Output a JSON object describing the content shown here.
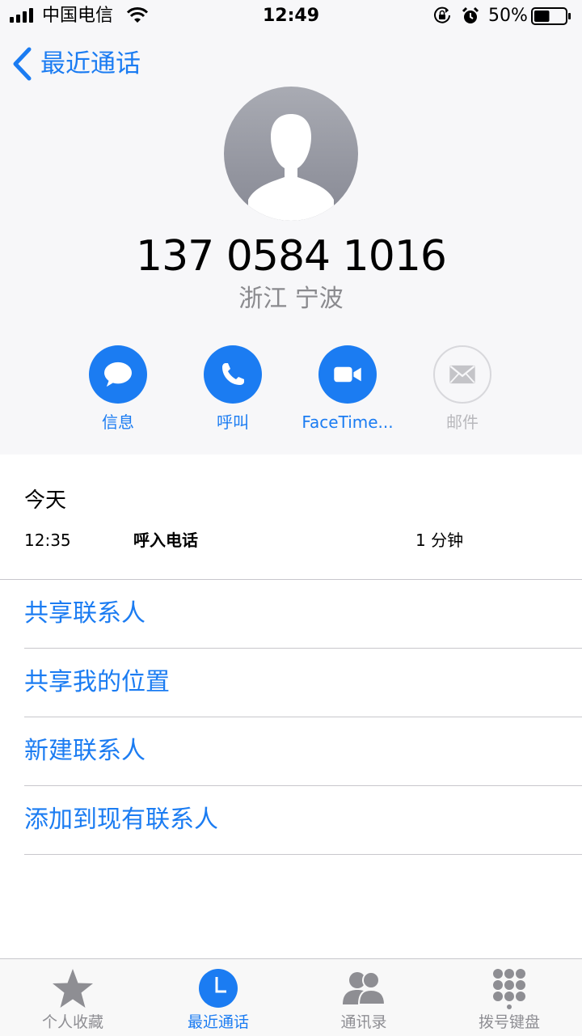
{
  "status_bar": {
    "carrier": "中国电信",
    "time": "12:49",
    "battery_percent": "50%",
    "battery_level": 0.5
  },
  "nav": {
    "back_label": "最近通话"
  },
  "contact": {
    "phone_number": "137 0584 1016",
    "location": "浙江 宁波"
  },
  "actions": [
    {
      "label": "信息",
      "icon": "message-icon",
      "enabled": true
    },
    {
      "label": "呼叫",
      "icon": "phone-icon",
      "enabled": true
    },
    {
      "label": "FaceTime...",
      "icon": "video-icon",
      "enabled": true
    },
    {
      "label": "邮件",
      "icon": "mail-icon",
      "enabled": false
    }
  ],
  "call_history": {
    "section_title": "今天",
    "entries": [
      {
        "time": "12:35",
        "type": "呼入电话",
        "duration": "1 分钟"
      }
    ]
  },
  "menu": [
    {
      "label": "共享联系人"
    },
    {
      "label": "共享我的位置"
    },
    {
      "label": "新建联系人"
    },
    {
      "label": "添加到现有联系人"
    }
  ],
  "tab_bar": {
    "tabs": [
      {
        "label": "个人收藏",
        "icon": "star-icon",
        "active": false
      },
      {
        "label": "最近通话",
        "icon": "clock-icon",
        "active": true
      },
      {
        "label": "通讯录",
        "icon": "contacts-icon",
        "active": false
      },
      {
        "label": "拨号键盘",
        "icon": "keypad-icon",
        "active": false
      }
    ]
  },
  "colors": {
    "accent": "#1b7cf2",
    "header_bg": "#f7f7f9",
    "secondary_text": "#8a8a8e",
    "divider": "#c8c7cc"
  }
}
